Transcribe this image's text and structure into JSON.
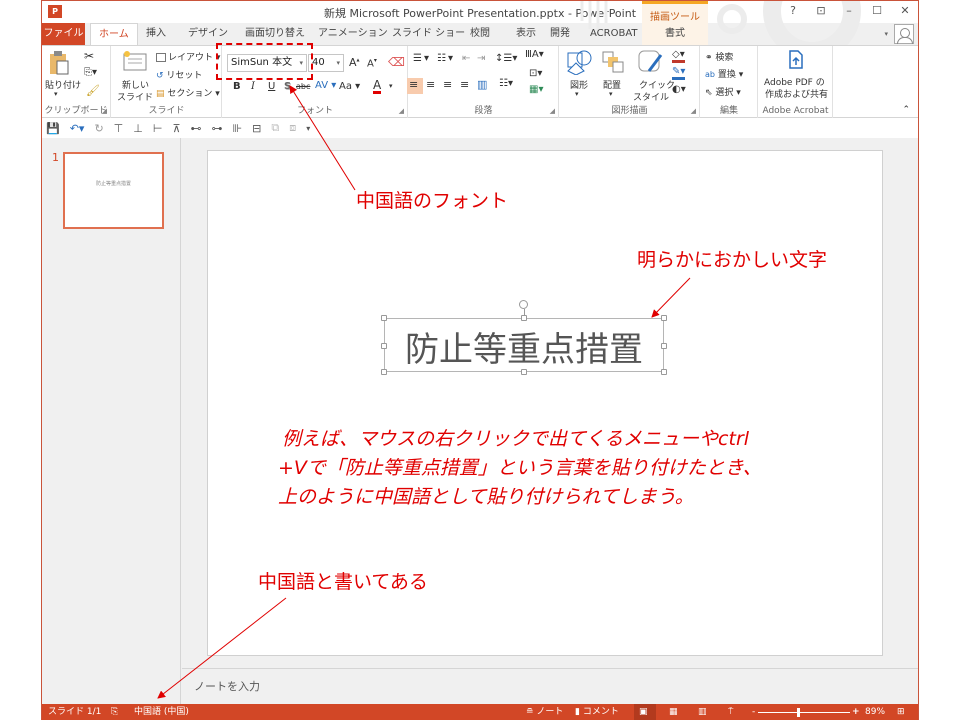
{
  "window": {
    "title": "新規 Microsoft PowerPoint Presentation.pptx - PowerPoint",
    "app_icon": "powerpoint-icon",
    "contextual_group": "描画ツール",
    "controls": [
      "?",
      "⊡",
      "–",
      "☐",
      "✕"
    ]
  },
  "tabs": [
    {
      "label": "ファイル"
    },
    {
      "label": "ホーム",
      "active": true
    },
    {
      "label": "挿入"
    },
    {
      "label": "デザイン"
    },
    {
      "label": "画面切り替え"
    },
    {
      "label": "アニメーション"
    },
    {
      "label": "スライド ショー"
    },
    {
      "label": "校閲"
    },
    {
      "label": "表示"
    },
    {
      "label": "開発"
    },
    {
      "label": "ACROBAT"
    },
    {
      "label": "書式"
    }
  ],
  "ribbon": {
    "clipboard": {
      "label": "クリップボード",
      "paste": "貼り付け"
    },
    "slides": {
      "label": "スライド",
      "new_slide_1": "新しい",
      "new_slide_2": "スライド",
      "layout": "レイアウト",
      "reset": "リセット",
      "section": "セクション"
    },
    "font": {
      "label": "フォント",
      "font_name": "SimSun 本文",
      "font_size": "40",
      "bold": "B",
      "italic": "I",
      "underline": "U",
      "shadow": "S",
      "strike": "abc",
      "spacing": "AV",
      "case": "Aa",
      "color": "A",
      "grow": "A",
      "shrink": "A"
    },
    "paragraph": {
      "label": "段落"
    },
    "drawing": {
      "label": "図形描画",
      "shapes": "図形",
      "arrange": "配置",
      "quick_style_1": "クイック",
      "quick_style_2": "スタイル"
    },
    "editing": {
      "label": "編集",
      "find": "検索",
      "replace": "置換",
      "select": "選択"
    },
    "acrobat": {
      "label": "Adobe Acrobat",
      "create_1": "Adobe PDF の",
      "create_2": "作成および共有"
    }
  },
  "thumbnails": [
    {
      "number": "1",
      "text": "防止等重点措置"
    }
  ],
  "slide": {
    "text": "防止等重点措置"
  },
  "notes": {
    "placeholder": "ノートを入力"
  },
  "statusbar": {
    "slide": "スライド 1/1",
    "language": "中国語 (中国)",
    "notes": "ノート",
    "comments": "コメント",
    "zoom_minus": "-",
    "zoom_plus": "+",
    "zoom": "89%",
    "zoom_fraction": 0.44
  },
  "annotations": {
    "font_note": "中国語のフォント",
    "char_note": "明らかにおかしい文字",
    "explain_1": "例えば、マウスの右クリックで出てくるメニューやctrl",
    "explain_2": "+Vで「防止等重点措置」という言葉を貼り付けたとき、",
    "explain_3": "上のように中国語として貼り付けられてしまう。",
    "lang_note": "中国語と書いてある",
    "color": "#e00000"
  }
}
